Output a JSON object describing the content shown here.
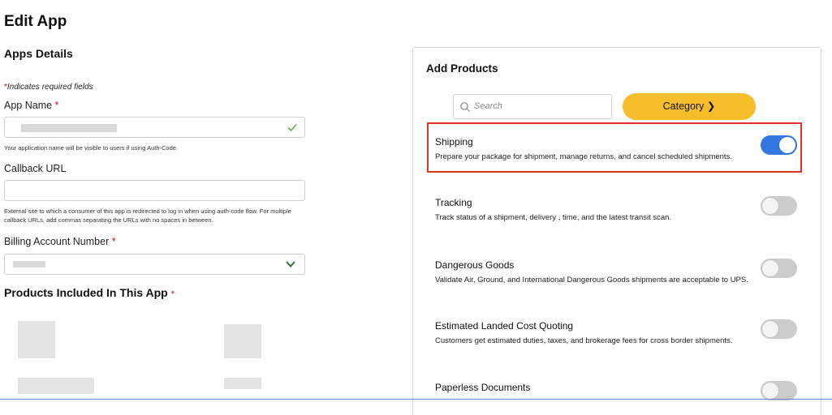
{
  "page": {
    "title": "Edit App",
    "section_title": "Apps Details",
    "required_note": "Indicates required fields",
    "required_marker": "*"
  },
  "app_name": {
    "label": "App Name",
    "required": "*",
    "helper": "Your application name will be visible to users if using Auth-Code.",
    "valid": true
  },
  "callback_url": {
    "label": "Callback URL",
    "value": "",
    "helper": "External site to which a consumer of this app is redirected to log in when using auth-code flow. For multiple callback URLs, add commas separating the URLs with no spaces in between."
  },
  "billing": {
    "label": "Billing Account Number",
    "required": "*"
  },
  "products_included": {
    "heading": "Products Included In This App",
    "required": "*"
  },
  "add_products": {
    "title": "Add Products",
    "search_placeholder": "Search",
    "category_button": "Category ❯",
    "items": [
      {
        "name": "Shipping",
        "desc": "Prepare your package for shipment, manage returns, and cancel scheduled shipments.",
        "enabled": true
      },
      {
        "name": "Tracking",
        "desc": "Track status of a shipment, delivery , time, and the latest transit scan.",
        "enabled": false
      },
      {
        "name": "Dangerous Goods",
        "desc": "Validate Air, Ground, and International Dangerous Goods shipments are acceptable to UPS.",
        "enabled": false
      },
      {
        "name": "Estimated Landed Cost Quoting",
        "desc": "Customers get estimated duties, taxes, and brokerage fees for cross border shipments.",
        "enabled": false
      },
      {
        "name": "Paperless Documents",
        "desc": "",
        "enabled": false
      }
    ]
  },
  "colors": {
    "accent_yellow": "#f6be2a",
    "toggle_on": "#3477e0",
    "toggle_off": "#cccccc",
    "required_red": "#d0021b",
    "highlight_red": "#e0342a",
    "valid_green": "#6aa84f"
  }
}
